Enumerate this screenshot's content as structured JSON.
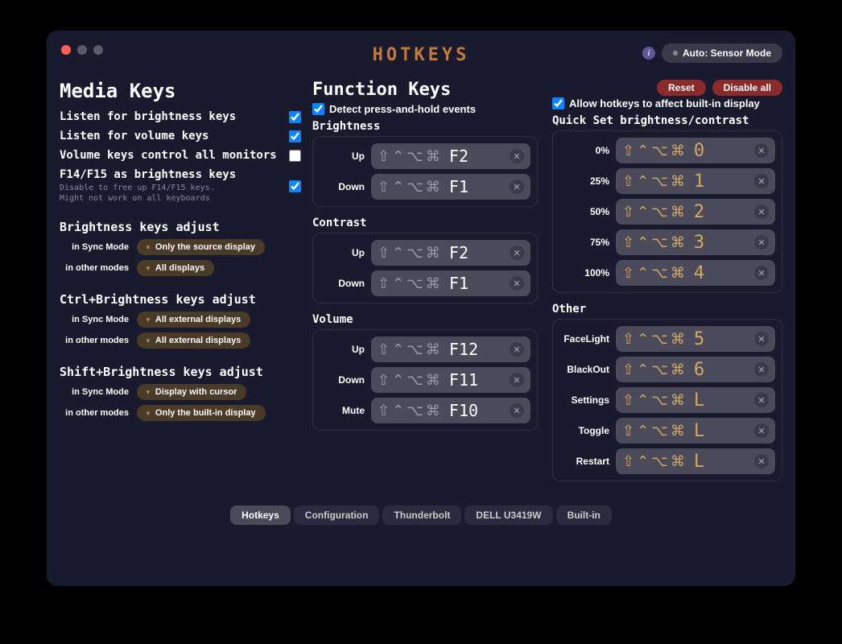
{
  "title": "HOTKEYS",
  "mode": "Auto: Sensor Mode",
  "media": {
    "heading": "Media Keys",
    "items": [
      {
        "label": "Listen for brightness keys",
        "checked": true
      },
      {
        "label": "Listen for volume keys",
        "checked": true
      },
      {
        "label": "Volume keys control all monitors",
        "checked": false
      },
      {
        "label": "F14/F15 as brightness keys",
        "checked": true,
        "sub": "Disable to free up F14/F15 keys.\nMight not work on all keyboards"
      }
    ],
    "adjust": [
      {
        "title": "Brightness keys adjust",
        "rows": [
          {
            "label": "in Sync Mode",
            "value": "Only the source display"
          },
          {
            "label": "in other modes",
            "value": "All displays"
          }
        ]
      },
      {
        "title": "Ctrl+Brightness keys adjust",
        "rows": [
          {
            "label": "in Sync Mode",
            "value": "All external displays"
          },
          {
            "label": "in other modes",
            "value": "All external displays"
          }
        ]
      },
      {
        "title": "Shift+Brightness keys adjust",
        "rows": [
          {
            "label": "in Sync Mode",
            "value": "Display with cursor"
          },
          {
            "label": "in other modes",
            "value": "Only the built-in display"
          }
        ]
      }
    ]
  },
  "function": {
    "heading": "Function Keys",
    "detect": "Detect press-and-hold events",
    "allow": "Allow hotkeys to affect built-in display",
    "reset": "Reset",
    "disable": "Disable all",
    "sections": {
      "brightness": {
        "title": "Brightness",
        "rows": [
          {
            "label": "Up",
            "mods": "⇧⌃⌥⌘",
            "key": "F2"
          },
          {
            "label": "Down",
            "mods": "⇧⌃⌥⌘",
            "key": "F1"
          }
        ]
      },
      "contrast": {
        "title": "Contrast",
        "rows": [
          {
            "label": "Up",
            "mods": "⇧⌃⌥⌘",
            "key": "F2"
          },
          {
            "label": "Down",
            "mods": "⇧⌃⌥⌘",
            "key": "F1"
          }
        ]
      },
      "volume": {
        "title": "Volume",
        "rows": [
          {
            "label": "Up",
            "mods": "⇧⌃⌥⌘",
            "key": "F12"
          },
          {
            "label": "Down",
            "mods": "⇧⌃⌥⌘",
            "key": "F11"
          },
          {
            "label": "Mute",
            "mods": "⇧⌃⌥⌘",
            "key": "F10"
          }
        ]
      }
    },
    "quick": {
      "title": "Quick Set brightness/contrast",
      "rows": [
        {
          "label": "0%",
          "mods": "⇧⌃⌥⌘",
          "key": "0"
        },
        {
          "label": "25%",
          "mods": "⇧⌃⌥⌘",
          "key": "1"
        },
        {
          "label": "50%",
          "mods": "⇧⌃⌥⌘",
          "key": "2"
        },
        {
          "label": "75%",
          "mods": "⇧⌃⌥⌘",
          "key": "3"
        },
        {
          "label": "100%",
          "mods": "⇧⌃⌥⌘",
          "key": "4"
        }
      ]
    },
    "other": {
      "title": "Other",
      "rows": [
        {
          "label": "FaceLight",
          "mods": "⇧⌃⌥⌘",
          "key": "5"
        },
        {
          "label": "BlackOut",
          "mods": "⇧⌃⌥⌘",
          "key": "6"
        },
        {
          "label": "Settings",
          "mods": "⇧⌃⌥⌘",
          "key": "L"
        },
        {
          "label": "Toggle",
          "mods": "⇧⌃⌥⌘",
          "key": "L"
        },
        {
          "label": "Restart",
          "mods": "⇧⌃⌥⌘",
          "key": "L"
        }
      ]
    }
  },
  "tabs": [
    "Hotkeys",
    "Configuration",
    "Thunderbolt",
    "DELL U3419W",
    "Built-in"
  ],
  "activeTab": 0
}
